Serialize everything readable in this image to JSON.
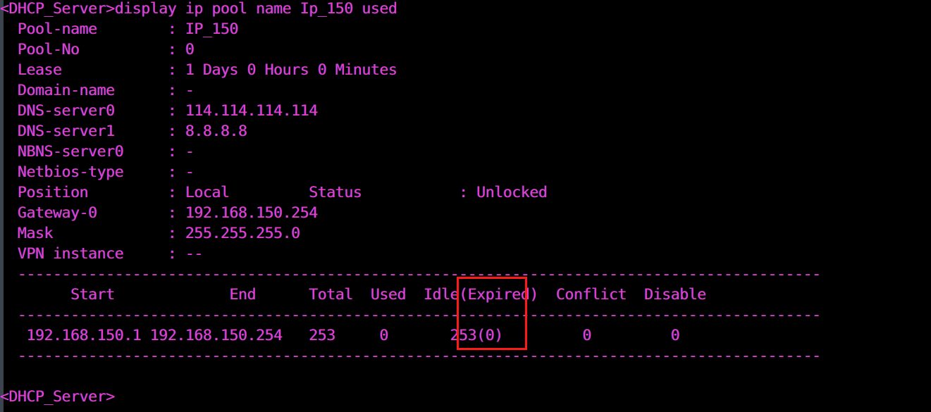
{
  "terminal": {
    "prompt": "<DHCP_Server>",
    "command": "display ip pool name Ip_150 used",
    "command_line": "<DHCP_Server>display ip pool name Ip_150 used",
    "trailing_prompt": "<DHCP_Server>",
    "text_color": "#e83ec8",
    "background_color": "#000000",
    "highlight_color": "#ff1a1a"
  },
  "pool_info": {
    "fields": [
      {
        "label": "Pool-name",
        "value": "IP_150"
      },
      {
        "label": "Pool-No",
        "value": "0"
      },
      {
        "label": "Lease",
        "value": "1 Days 0 Hours 0 Minutes"
      },
      {
        "label": "Domain-name",
        "value": "-"
      },
      {
        "label": "DNS-server0",
        "value": "114.114.114.114"
      },
      {
        "label": "DNS-server1",
        "value": "8.8.8.8"
      },
      {
        "label": "NBNS-server0",
        "value": "-"
      },
      {
        "label": "Netbios-type",
        "value": "-"
      },
      {
        "label": "Position",
        "value": "Local"
      },
      {
        "label": "Gateway-0",
        "value": "192.168.150.254"
      },
      {
        "label": "Mask",
        "value": "255.255.255.0"
      },
      {
        "label": "VPN instance",
        "value": "--"
      }
    ],
    "status_label": "Status",
    "status_value": "Unlocked"
  },
  "table": {
    "separator": "  ---------------------------------------------------------------------------------------",
    "headers": [
      "Start",
      "End",
      "Total",
      "Used",
      "Idle(Expired)",
      "Conflict",
      "Disable"
    ],
    "header_line": "        Start               End      Total   Used  Idle(Expired)  Conflict  Disable",
    "rows": [
      {
        "start": "192.168.150.1",
        "end": "192.168.150.254",
        "total": "253",
        "used": "0",
        "idle_expired": "253(0)",
        "conflict": "0",
        "disable": "0",
        "line": "   192.168.150.1 192.168.150.254    253     0       253(0)         0         0"
      }
    ]
  },
  "screen_text": {
    "line_01": "<DHCP_Server>display ip pool name Ip_150 used",
    "line_02": "  Pool-name        : IP_150",
    "line_03": "  Pool-No          : 0",
    "line_04": "  Lease            : 1 Days 0 Hours 0 Minutes",
    "line_05": "  Domain-name      : -",
    "line_06": "  DNS-server0      : 114.114.114.114",
    "line_07": "  DNS-server1      : 8.8.8.8",
    "line_08": "  NBNS-server0     : -",
    "line_09": "  Netbios-type     : -",
    "line_10": "  Position         : Local         Status           : Unlocked",
    "line_11": "  Gateway-0        : 192.168.150.254",
    "line_12": "  Mask             : 255.255.255.0",
    "line_13": "  VPN instance     : --",
    "line_14": "  -------------------------------------------------------------------------------------------",
    "line_15": "        Start             End      Total  Used  Idle(Expired)  Conflict  Disable",
    "line_16": "  -------------------------------------------------------------------------------------------",
    "line_17": "   192.168.150.1 192.168.150.254   253     0       253(0)         0         0",
    "line_18": "  -------------------------------------------------------------------------------------------",
    "line_19": "",
    "line_20": "<DHCP_Server>"
  }
}
